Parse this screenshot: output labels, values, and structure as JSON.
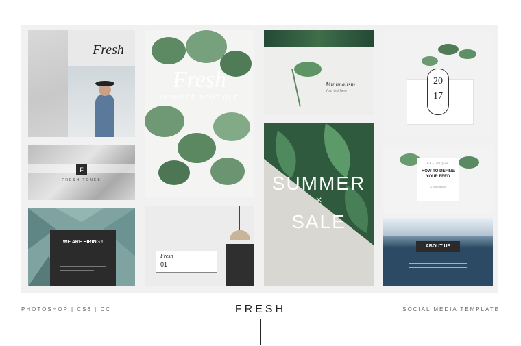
{
  "tiles": {
    "t1": {
      "title": "Fresh"
    },
    "t2": {
      "title": "Fresh",
      "subtitle": "INSPIRED BOUTIQUE"
    },
    "t3": {
      "title": "Minimalism",
      "line": "Your text here"
    },
    "t4": {
      "year_top": "20",
      "year_bottom": "17"
    },
    "t5": {
      "badge": "F",
      "caption": "FRESH TONES"
    },
    "t6": {
      "title_top": "SUMMER",
      "divider": "×",
      "title_bottom": "SALE"
    },
    "t7": {
      "kicker": "BEAUTIQUE",
      "headline": "HOW TO DEFINE YOUR FEED",
      "sub": "a short guide"
    },
    "t8": {
      "headline": "WE ARE HIRING !"
    },
    "t9": {
      "title": "Fresh",
      "number": "01"
    },
    "t10": {
      "label": "ABOUT US"
    }
  },
  "footer": {
    "left": "PHOTOSHOP | CS6 | CC",
    "center": "FRESH",
    "right": "SOCIAL MEDIA TEMPLATE"
  },
  "colors": {
    "background": "#ffffff",
    "board": "#f1f1f1",
    "dark": "#2b2b2b",
    "green": "#3f6e4a"
  }
}
